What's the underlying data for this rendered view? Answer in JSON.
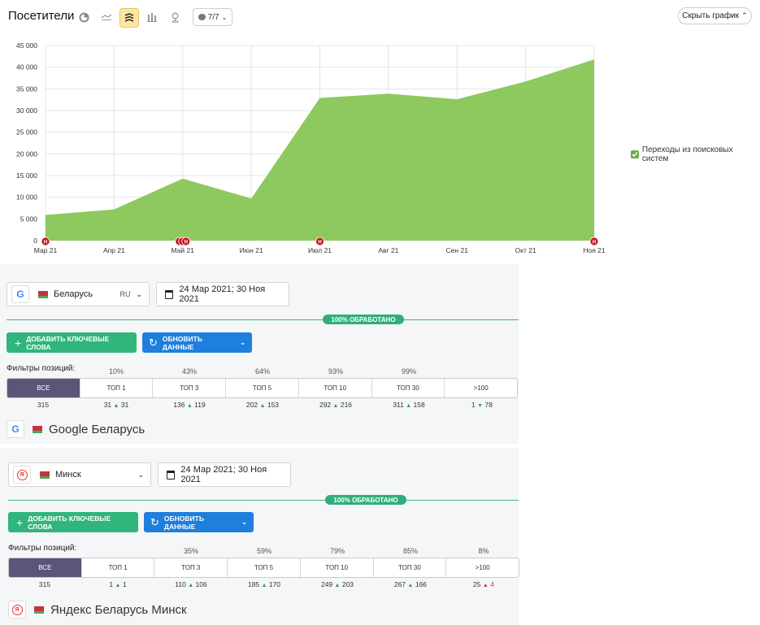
{
  "header": {
    "title": "Посетители",
    "annotations_label": "7/7",
    "hide_chart_label": "Скрыть график"
  },
  "legend": {
    "label": "Переходы из поисковых систем",
    "color": "#8dc95e"
  },
  "chart_data": {
    "type": "area",
    "categories": [
      "Мар 21",
      "Апр 21",
      "Май 21",
      "Июн 21",
      "Июл 21",
      "Авг 21",
      "Сен 21",
      "Окт 21",
      "Ноя 21"
    ],
    "x": [
      0,
      1,
      2,
      3,
      4,
      5,
      6,
      7,
      8
    ],
    "series": [
      {
        "name": "Переходы из поисковых систем",
        "values": [
          5900,
          7200,
          14300,
          9700,
          32900,
          33900,
          32600,
          36700,
          41800
        ],
        "color": "#8dc95e"
      }
    ],
    "y_ticks": [
      "0",
      "5 000",
      "10 000",
      "15 000",
      "20 000",
      "25 000",
      "30 000",
      "35 000",
      "40 000",
      "45 000"
    ],
    "ylim": [
      0,
      45000
    ],
    "grid": true,
    "legend_position": "right",
    "markers": [
      {
        "x": 0,
        "label": "Н"
      },
      {
        "x": 2,
        "label": "Н"
      },
      {
        "x": 4,
        "label": "Н"
      },
      {
        "x": 8,
        "label": "Н"
      }
    ]
  },
  "panels": [
    {
      "engine_letter": "G",
      "region": "Беларусь",
      "lang": "RU",
      "date_range": "24 Мар 2021; 30 Ноя 2021",
      "processed": "100% ОБРАБОТАНО",
      "add_keywords": "ДОБАВИТЬ КЛЮЧЕВЫЕ СЛОВА",
      "update_data": "ОБНОВИТЬ ДАННЫЕ",
      "filters_label": "Фильтры позиций:",
      "percents": [
        "10%",
        "43%",
        "64%",
        "93%",
        "99%",
        ""
      ],
      "filters": [
        "ВСЕ",
        "ТОП 1",
        "ТОП 3",
        "ТОП 5",
        "ТОП 10",
        "ТОП 30",
        ">100"
      ],
      "counts": [
        {
          "total": "315"
        },
        {
          "total": "31",
          "delta": "31",
          "dir": "up"
        },
        {
          "total": "136",
          "delta": "119",
          "dir": "up"
        },
        {
          "total": "202",
          "delta": "153",
          "dir": "up"
        },
        {
          "total": "292",
          "delta": "216",
          "dir": "up"
        },
        {
          "total": "311",
          "delta": "158",
          "dir": "up"
        },
        {
          "total": "1",
          "delta": "78",
          "dir": "down"
        }
      ],
      "engine_title": "Google Беларусь"
    },
    {
      "engine_letter": "Я",
      "region": "Минск",
      "lang": "",
      "date_range": "24 Мар 2021; 30 Ноя 2021",
      "processed": "100% ОБРАБОТАНО",
      "add_keywords": "ДОБАВИТЬ КЛЮЧЕВЫЕ СЛОВА",
      "update_data": "ОБНОВИТЬ ДАННЫЕ",
      "filters_label": "Фильтры позиций:",
      "percents": [
        "",
        "35%",
        "59%",
        "79%",
        "85%",
        "8%"
      ],
      "filters": [
        "ВСЕ",
        "ТОП 1",
        "ТОП 3",
        "ТОП 5",
        "ТОП 10",
        "ТОП 30",
        ">100"
      ],
      "counts": [
        {
          "total": "315"
        },
        {
          "total": "1",
          "delta": "1",
          "dir": "up"
        },
        {
          "total": "110",
          "delta": "106",
          "dir": "up"
        },
        {
          "total": "185",
          "delta": "170",
          "dir": "up"
        },
        {
          "total": "249",
          "delta": "203",
          "dir": "up"
        },
        {
          "total": "267",
          "delta": "166",
          "dir": "up"
        },
        {
          "total": "25",
          "delta": "4",
          "dir": "up-red"
        }
      ],
      "engine_title": "Яндекс Беларусь Минск"
    }
  ]
}
